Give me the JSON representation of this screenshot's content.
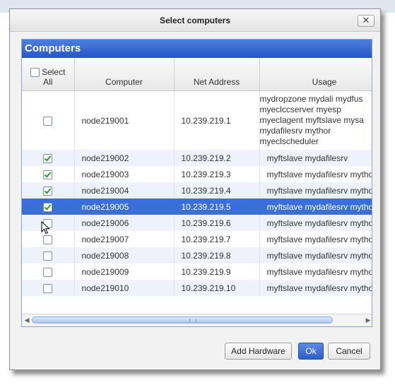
{
  "dialog": {
    "title": "Select computers",
    "close_glyph": "✕"
  },
  "panel": {
    "title": "Computers"
  },
  "table": {
    "select_all_label_1": "Select",
    "select_all_label_2": "All",
    "columns": [
      "Computer",
      "Net Address",
      "Usage"
    ],
    "rows": [
      {
        "checked": false,
        "computer": "node219001",
        "address": "10.239.219.1",
        "usage_lines": [
          "mydropzone mydali mydfus",
          "myeclccserver myesp",
          "myeclagent myftslave mysa",
          "mydafilesrv mythor",
          "myeclscheduler"
        ]
      },
      {
        "checked": true,
        "computer": "node219002",
        "address": "10.239.219.2",
        "usage": "myftslave mydafilesrv"
      },
      {
        "checked": true,
        "computer": "node219003",
        "address": "10.239.219.3",
        "usage": "myftslave mydafilesrv mytho"
      },
      {
        "checked": true,
        "computer": "node219004",
        "address": "10.239.219.4",
        "usage": "myftslave mydafilesrv mytho"
      },
      {
        "checked": true,
        "computer": "node219005",
        "address": "10.239.219.5",
        "usage": "myftslave mydafilesrv mytho",
        "selected": true
      },
      {
        "checked": false,
        "computer": "node219006",
        "address": "10.239.219.6",
        "usage": "myftslave mydafilesrv mytho"
      },
      {
        "checked": false,
        "computer": "node219007",
        "address": "10.239.219.7",
        "usage": "myftslave mydafilesrv mytho"
      },
      {
        "checked": false,
        "computer": "node219008",
        "address": "10.239.219.8",
        "usage": "myftslave mydafilesrv mytho"
      },
      {
        "checked": false,
        "computer": "node219009",
        "address": "10.239.219.9",
        "usage": "myftslave mydafilesrv mytho"
      },
      {
        "checked": false,
        "computer": "node219010",
        "address": "10.239.219.10",
        "usage": "myftslave mydafilesrv mytho"
      }
    ]
  },
  "scrollbar": {
    "left_arrow": "◀",
    "right_arrow": "▶"
  },
  "buttons": {
    "add_hardware": "Add Hardware",
    "ok": "Ok",
    "cancel": "Cancel"
  },
  "colors": {
    "header_blue": "#2457c8",
    "selected_row": "#3a6fd8",
    "check_green": "#2c9a2c"
  }
}
